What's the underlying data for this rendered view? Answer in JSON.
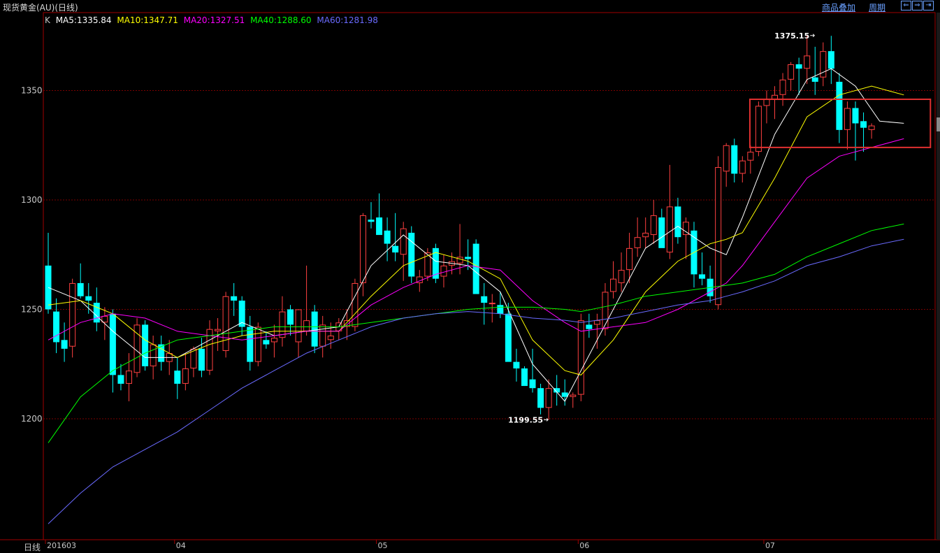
{
  "header": {
    "title": "现货黄金(AU)(日线)",
    "link_product_add": "商品叠加",
    "link_period": "周期",
    "nav_left_icon": "arrow-left-box-icon",
    "nav_right_icon": "arrow-right-box-icon",
    "nav_right2_icon": "arrow-right-end-icon"
  },
  "legend": {
    "k": "K",
    "ma5": "MA5:1335.84",
    "ma10": "MA10:1347.71",
    "ma20": "MA20:1327.51",
    "ma40": "MA40:1288.60",
    "ma60": "MA60:1281.98"
  },
  "footer": {
    "period_label": "日线"
  },
  "colors": {
    "up": "#ff4040",
    "down": "#00ffff",
    "ma5": "#ffffff",
    "ma10": "#ffff00",
    "ma20": "#ff00ff",
    "ma40": "#00ff00",
    "ma60": "#6a6aff",
    "grid": "#7a0000",
    "highlight": "#e03030"
  },
  "chart_data": {
    "type": "candlestick",
    "title": "现货黄金(AU)(日线)",
    "ylim": [
      1150,
      1390
    ],
    "y_ticks": [
      1200,
      1250,
      1300,
      1350
    ],
    "x_tick_labels": [
      {
        "i": 0,
        "label": "201603"
      },
      {
        "i": 16,
        "label": "04"
      },
      {
        "i": 41,
        "label": "05"
      },
      {
        "i": 66,
        "label": "06"
      },
      {
        "i": 89,
        "label": "07"
      }
    ],
    "annotations": [
      {
        "i": 95,
        "value": 1375.15,
        "text": "1375.15"
      },
      {
        "i": 62,
        "value": 1199.55,
        "text": "1199.55"
      }
    ],
    "candles": [
      [
        1270,
        1285,
        1248,
        1250
      ],
      [
        1249,
        1255,
        1230,
        1235
      ],
      [
        1236,
        1244,
        1226,
        1232
      ],
      [
        1233,
        1264,
        1228,
        1262
      ],
      [
        1262,
        1271,
        1255,
        1256
      ],
      [
        1256,
        1262,
        1248,
        1254
      ],
      [
        1253,
        1260,
        1240,
        1244
      ],
      [
        1244,
        1251,
        1236,
        1247
      ],
      [
        1248,
        1250,
        1212,
        1220
      ],
      [
        1220,
        1225,
        1213,
        1216
      ],
      [
        1216,
        1230,
        1208,
        1222
      ],
      [
        1221,
        1246,
        1219,
        1243
      ],
      [
        1243,
        1245,
        1222,
        1224
      ],
      [
        1224,
        1238,
        1218,
        1234
      ],
      [
        1234,
        1238,
        1222,
        1226
      ],
      [
        1226,
        1236,
        1220,
        1230
      ],
      [
        1222,
        1228,
        1209,
        1216
      ],
      [
        1216,
        1230,
        1213,
        1223
      ],
      [
        1223,
        1233,
        1219,
        1232
      ],
      [
        1232,
        1237,
        1219,
        1222
      ],
      [
        1222,
        1245,
        1220,
        1241
      ],
      [
        1240,
        1246,
        1231,
        1241
      ],
      [
        1231,
        1258,
        1228,
        1256
      ],
      [
        1256,
        1262,
        1247,
        1254
      ],
      [
        1254,
        1256,
        1238,
        1242
      ],
      [
        1242,
        1247,
        1222,
        1226
      ],
      [
        1226,
        1244,
        1224,
        1242
      ],
      [
        1236,
        1240,
        1232,
        1234
      ],
      [
        1235,
        1243,
        1228,
        1237
      ],
      [
        1237,
        1256,
        1233,
        1249
      ],
      [
        1250,
        1252,
        1238,
        1243
      ],
      [
        1235,
        1248,
        1228,
        1250
      ],
      [
        1240,
        1270,
        1238,
        1245
      ],
      [
        1249,
        1252,
        1230,
        1233
      ],
      [
        1233,
        1247,
        1228,
        1243
      ],
      [
        1236,
        1244,
        1232,
        1238
      ],
      [
        1240,
        1246,
        1236,
        1244
      ],
      [
        1242,
        1250,
        1236,
        1245
      ],
      [
        1242,
        1264,
        1240,
        1262
      ],
      [
        1262,
        1294,
        1256,
        1293
      ],
      [
        1291,
        1299,
        1287,
        1290
      ],
      [
        1292,
        1303,
        1286,
        1284
      ],
      [
        1286,
        1292,
        1272,
        1280
      ],
      [
        1279,
        1294,
        1272,
        1276
      ],
      [
        1275,
        1290,
        1263,
        1287
      ],
      [
        1285,
        1288,
        1262,
        1265
      ],
      [
        1262,
        1268,
        1258,
        1265
      ],
      [
        1265,
        1278,
        1263,
        1276
      ],
      [
        1278,
        1280,
        1262,
        1264
      ],
      [
        1265,
        1275,
        1260,
        1270
      ],
      [
        1270,
        1276,
        1266,
        1272
      ],
      [
        1271,
        1289,
        1266,
        1274
      ],
      [
        1274,
        1282,
        1268,
        1273
      ],
      [
        1280,
        1282,
        1262,
        1257
      ],
      [
        1256,
        1262,
        1243,
        1253
      ],
      [
        1253,
        1257,
        1244,
        1253
      ],
      [
        1252,
        1258,
        1246,
        1248
      ],
      [
        1248,
        1253,
        1227,
        1226
      ],
      [
        1226,
        1232,
        1217,
        1223
      ],
      [
        1223,
        1224,
        1215,
        1215
      ],
      [
        1218,
        1232,
        1212,
        1214
      ],
      [
        1214,
        1216,
        1202,
        1205
      ],
      [
        1205,
        1218,
        1199.55,
        1214
      ],
      [
        1214,
        1220,
        1206,
        1212
      ],
      [
        1212,
        1218,
        1206,
        1210
      ],
      [
        1210,
        1212,
        1205,
        1211
      ],
      [
        1211,
        1248,
        1208,
        1245
      ],
      [
        1243,
        1248,
        1237,
        1241
      ],
      [
        1243,
        1248,
        1232,
        1245
      ],
      [
        1241,
        1262,
        1238,
        1258
      ],
      [
        1258,
        1272,
        1255,
        1264
      ],
      [
        1262,
        1276,
        1258,
        1268
      ],
      [
        1268,
        1285,
        1262,
        1278
      ],
      [
        1278,
        1292,
        1274,
        1283
      ],
      [
        1283,
        1292,
        1278,
        1285
      ],
      [
        1284,
        1300,
        1280,
        1293
      ],
      [
        1292,
        1296,
        1285,
        1278
      ],
      [
        1276,
        1316,
        1273,
        1297
      ],
      [
        1297,
        1301,
        1280,
        1283
      ],
      [
        1284,
        1292,
        1273,
        1290
      ],
      [
        1286,
        1290,
        1260,
        1266
      ],
      [
        1266,
        1276,
        1261,
        1264
      ],
      [
        1264,
        1270,
        1253,
        1256
      ],
      [
        1252,
        1320,
        1250,
        1315
      ],
      [
        1313,
        1326,
        1306,
        1325
      ],
      [
        1325,
        1328,
        1308,
        1312
      ],
      [
        1312,
        1320,
        1308,
        1318
      ],
      [
        1318,
        1325,
        1312,
        1322
      ],
      [
        1322,
        1345,
        1320,
        1343
      ],
      [
        1343,
        1350,
        1335,
        1346
      ],
      [
        1346,
        1352,
        1337,
        1348
      ],
      [
        1348,
        1358,
        1343,
        1355
      ],
      [
        1355,
        1363,
        1350,
        1362
      ],
      [
        1362,
        1365,
        1348,
        1360
      ],
      [
        1360,
        1375.15,
        1353,
        1366
      ],
      [
        1356,
        1370,
        1348,
        1354
      ],
      [
        1356,
        1372,
        1352,
        1368
      ],
      [
        1368,
        1375,
        1353,
        1360
      ],
      [
        1354,
        1358,
        1326,
        1332
      ],
      [
        1332,
        1345,
        1323,
        1342
      ],
      [
        1342,
        1345,
        1318,
        1335
      ],
      [
        1336,
        1340,
        1322,
        1333
      ],
      [
        1332,
        1335,
        1328,
        1334
      ]
    ],
    "series": [
      {
        "name": "MA5",
        "points": [
          [
            0,
            1260
          ],
          [
            4,
            1254
          ],
          [
            8,
            1240
          ],
          [
            12,
            1228
          ],
          [
            16,
            1228
          ],
          [
            20,
            1236
          ],
          [
            24,
            1244
          ],
          [
            28,
            1238
          ],
          [
            32,
            1240
          ],
          [
            36,
            1242
          ],
          [
            40,
            1270
          ],
          [
            44,
            1284
          ],
          [
            48,
            1272
          ],
          [
            52,
            1270
          ],
          [
            56,
            1258
          ],
          [
            60,
            1225
          ],
          [
            64,
            1208
          ],
          [
            66,
            1222
          ],
          [
            70,
            1250
          ],
          [
            74,
            1278
          ],
          [
            78,
            1288
          ],
          [
            82,
            1278
          ],
          [
            84,
            1275
          ],
          [
            86,
            1292
          ],
          [
            90,
            1330
          ],
          [
            94,
            1355
          ],
          [
            97,
            1360
          ],
          [
            100,
            1352
          ],
          [
            103,
            1336
          ],
          [
            106,
            1335
          ]
        ]
      },
      {
        "name": "MA10",
        "points": [
          [
            0,
            1252
          ],
          [
            4,
            1254
          ],
          [
            8,
            1248
          ],
          [
            12,
            1236
          ],
          [
            16,
            1228
          ],
          [
            20,
            1234
          ],
          [
            24,
            1238
          ],
          [
            28,
            1240
          ],
          [
            32,
            1240
          ],
          [
            36,
            1240
          ],
          [
            40,
            1256
          ],
          [
            44,
            1270
          ],
          [
            48,
            1276
          ],
          [
            52,
            1272
          ],
          [
            56,
            1264
          ],
          [
            60,
            1236
          ],
          [
            64,
            1222
          ],
          [
            66,
            1220
          ],
          [
            70,
            1236
          ],
          [
            74,
            1258
          ],
          [
            78,
            1272
          ],
          [
            82,
            1280
          ],
          [
            84,
            1282
          ],
          [
            86,
            1285
          ],
          [
            90,
            1310
          ],
          [
            94,
            1338
          ],
          [
            98,
            1348
          ],
          [
            102,
            1352
          ],
          [
            106,
            1348
          ]
        ]
      },
      {
        "name": "MA20",
        "points": [
          [
            0,
            1236
          ],
          [
            4,
            1244
          ],
          [
            8,
            1248
          ],
          [
            12,
            1246
          ],
          [
            16,
            1240
          ],
          [
            20,
            1238
          ],
          [
            24,
            1236
          ],
          [
            28,
            1238
          ],
          [
            32,
            1240
          ],
          [
            36,
            1240
          ],
          [
            40,
            1252
          ],
          [
            44,
            1260
          ],
          [
            48,
            1266
          ],
          [
            52,
            1270
          ],
          [
            56,
            1268
          ],
          [
            60,
            1254
          ],
          [
            64,
            1244
          ],
          [
            66,
            1240
          ],
          [
            70,
            1242
          ],
          [
            74,
            1244
          ],
          [
            78,
            1250
          ],
          [
            82,
            1258
          ],
          [
            84,
            1262
          ],
          [
            86,
            1270
          ],
          [
            90,
            1290
          ],
          [
            94,
            1310
          ],
          [
            98,
            1320
          ],
          [
            102,
            1324
          ],
          [
            106,
            1328
          ]
        ]
      },
      {
        "name": "MA40",
        "points": [
          [
            0,
            1189
          ],
          [
            4,
            1210
          ],
          [
            8,
            1222
          ],
          [
            12,
            1230
          ],
          [
            16,
            1236
          ],
          [
            20,
            1238
          ],
          [
            24,
            1240
          ],
          [
            28,
            1242
          ],
          [
            32,
            1242
          ],
          [
            36,
            1242
          ],
          [
            40,
            1244
          ],
          [
            44,
            1246
          ],
          [
            48,
            1248
          ],
          [
            52,
            1250
          ],
          [
            56,
            1251
          ],
          [
            60,
            1251
          ],
          [
            64,
            1250
          ],
          [
            66,
            1249
          ],
          [
            70,
            1252
          ],
          [
            74,
            1256
          ],
          [
            78,
            1258
          ],
          [
            82,
            1260
          ],
          [
            84,
            1261
          ],
          [
            86,
            1262
          ],
          [
            90,
            1266
          ],
          [
            94,
            1274
          ],
          [
            98,
            1280
          ],
          [
            102,
            1286
          ],
          [
            106,
            1289
          ]
        ]
      },
      {
        "name": "MA60",
        "points": [
          [
            0,
            1152
          ],
          [
            4,
            1166
          ],
          [
            8,
            1178
          ],
          [
            12,
            1186
          ],
          [
            16,
            1194
          ],
          [
            20,
            1204
          ],
          [
            24,
            1214
          ],
          [
            28,
            1222
          ],
          [
            32,
            1230
          ],
          [
            36,
            1236
          ],
          [
            40,
            1242
          ],
          [
            44,
            1246
          ],
          [
            48,
            1248
          ],
          [
            52,
            1249
          ],
          [
            56,
            1248
          ],
          [
            60,
            1246
          ],
          [
            64,
            1245
          ],
          [
            66,
            1244
          ],
          [
            70,
            1246
          ],
          [
            74,
            1249
          ],
          [
            78,
            1252
          ],
          [
            82,
            1254
          ],
          [
            84,
            1256
          ],
          [
            86,
            1258
          ],
          [
            90,
            1263
          ],
          [
            94,
            1270
          ],
          [
            98,
            1274
          ],
          [
            102,
            1279
          ],
          [
            106,
            1282
          ]
        ]
      }
    ],
    "highlight_box": {
      "i_start": 89,
      "i_end": 106,
      "y_top": 1346,
      "y_bottom": 1324
    }
  }
}
